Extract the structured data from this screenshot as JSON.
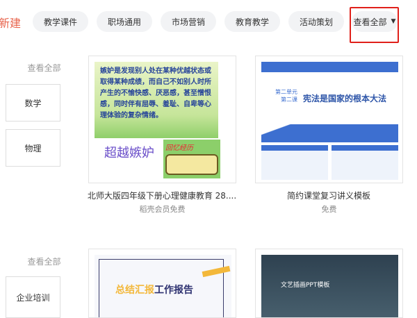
{
  "header": {
    "new_label": "新建",
    "tags": [
      "教学课件",
      "职场通用",
      "市场营销",
      "教育教学",
      "活动策划"
    ],
    "view_all_dropdown": "查看全部"
  },
  "sections": [
    {
      "view_all": "查看全部",
      "categories": [
        "数学",
        "物理"
      ],
      "cards": [
        {
          "title": "北师大版四年级下册心理健康教育 28....",
          "price": "稻壳会员免费",
          "thumb": {
            "main_text": "嫉妒是发现别人处在某种优越状态或取得某种成绩，而自己不如别人时所产生的不愉快感、厌恶感，甚至憎恨感，同时伴有屈辱、羞耻、自卑等心理体验的复杂情绪。",
            "caption": "超越嫉妒",
            "badge": "回忆经历"
          }
        },
        {
          "title": "简约课堂复习讲义模板",
          "price": "免费",
          "thumb": {
            "heading": "宪法是国家的根本大法",
            "unit": "第二单元",
            "lesson": "第二课"
          }
        }
      ]
    },
    {
      "view_all": "查看全部",
      "categories": [
        "企业培训"
      ],
      "cards": [
        {
          "thumb": {
            "heading_a": "总结汇报",
            "heading_b": "工作报告"
          }
        },
        {
          "thumb": {
            "heading": "文艺插画PPT模板"
          }
        }
      ]
    }
  ],
  "colors": {
    "accent": "#e8654e",
    "highlight_border": "#e0201a"
  }
}
